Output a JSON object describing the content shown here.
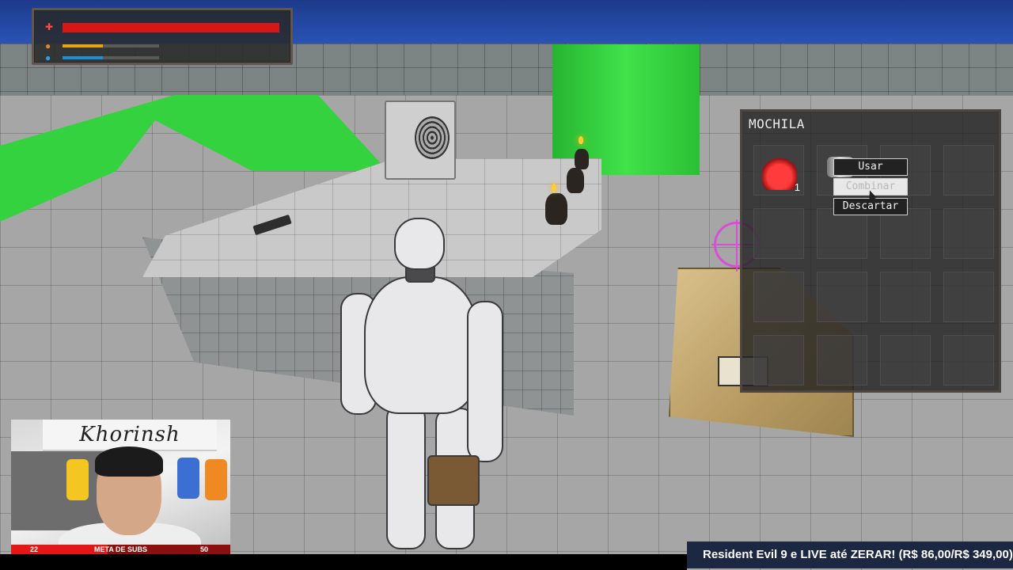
{
  "hud": {
    "health": {
      "icon": "health-icon",
      "level": 1.0,
      "color": "#d91616"
    },
    "hunger": {
      "icon": "food-icon",
      "level": 0.42,
      "color": "#e5a718"
    },
    "thirst": {
      "icon": "water-drop-icon",
      "level": 0.42,
      "color": "#1e8fd6"
    }
  },
  "inventory": {
    "title": "MOCHILA",
    "slots": [
      {
        "item": "red-potion",
        "count": "1"
      },
      {
        "item": "metal-canister",
        "count": ""
      }
    ],
    "context_menu": {
      "use": "Usar",
      "combine": "Combinar",
      "discard": "Descartar"
    }
  },
  "crosshair": {
    "icon": "crosshair-icon",
    "color": "#e23fe0"
  },
  "webcam": {
    "banner": "Khorinsh",
    "sub_goal": {
      "label": "META DE SUBS",
      "current": "22",
      "target": "50",
      "progress": 0.44
    }
  },
  "ticker": {
    "text": "Resident Evil 9 e LIVE até ZERAR! (R$ 86,00/R$ 349,00)"
  }
}
